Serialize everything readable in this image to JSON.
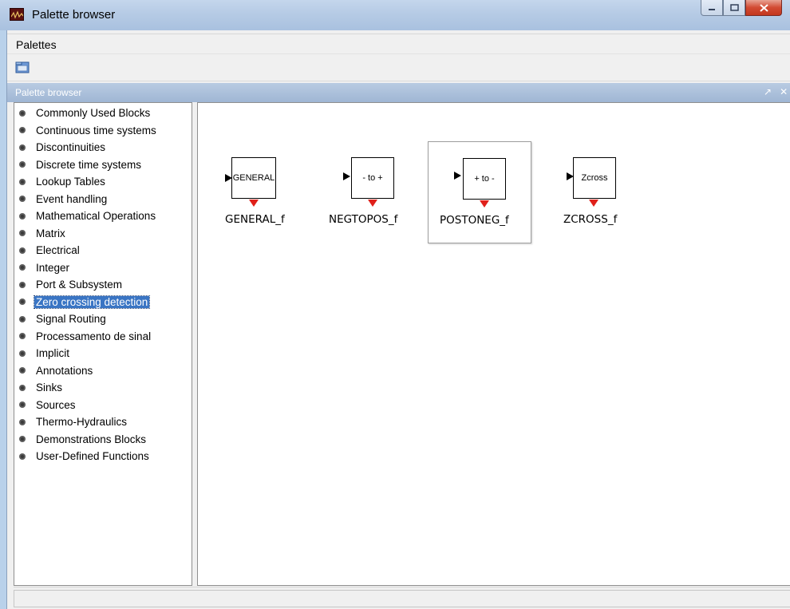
{
  "window": {
    "title": "Palette browser"
  },
  "menubar": {
    "items": [
      "Palettes"
    ]
  },
  "toolbar": {
    "buttons": [
      {
        "icon": "open-palette-icon"
      }
    ]
  },
  "panel": {
    "title": "Palette browser",
    "controls": [
      "↗",
      "✕"
    ]
  },
  "tree": {
    "selected_index": 11,
    "items": [
      "Commonly Used Blocks",
      "Continuous time systems",
      "Discontinuities",
      "Discrete time systems",
      "Lookup Tables",
      "Event handling",
      "Mathematical Operations",
      "Matrix",
      "Electrical",
      "Integer",
      "Port & Subsystem",
      "Zero crossing detection",
      "Signal Routing",
      "Processamento de sinal",
      "Implicit",
      "Annotations",
      "Sinks",
      "Sources",
      "Thermo-Hydraulics",
      "Demonstrations Blocks",
      "User-Defined Functions"
    ]
  },
  "blocks": [
    {
      "box_label": "GENERAL",
      "name": "GENERAL_f"
    },
    {
      "box_label": "- to +",
      "name": "NEGTOPOS_f"
    },
    {
      "box_label": "+ to -",
      "name": "POSTONEG_f"
    },
    {
      "box_label": "Zcross",
      "name": "ZCROSS_f"
    }
  ],
  "colors": {
    "event_port": "#e0201a",
    "selection": "#3a75c4"
  }
}
